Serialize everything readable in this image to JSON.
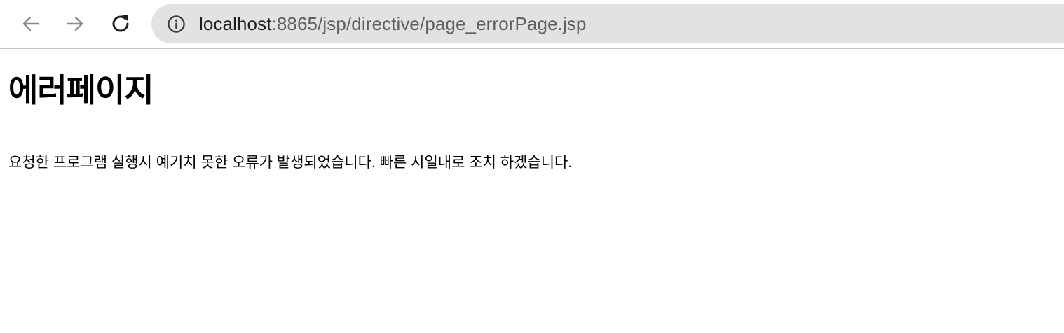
{
  "browser": {
    "url_host": "localhost",
    "url_rest": ":8865/jsp/directive/page_errorPage.jsp",
    "icons": {
      "back": "arrow-left-icon",
      "forward": "arrow-right-icon",
      "reload": "reload-icon",
      "site_info": "info-icon"
    }
  },
  "page": {
    "heading": "에러페이지",
    "message": "요청한 프로그램 실행시 예기치 못한 오류가 발생되었습니다. 빠른 시일내로 조치 하겠습니다."
  }
}
